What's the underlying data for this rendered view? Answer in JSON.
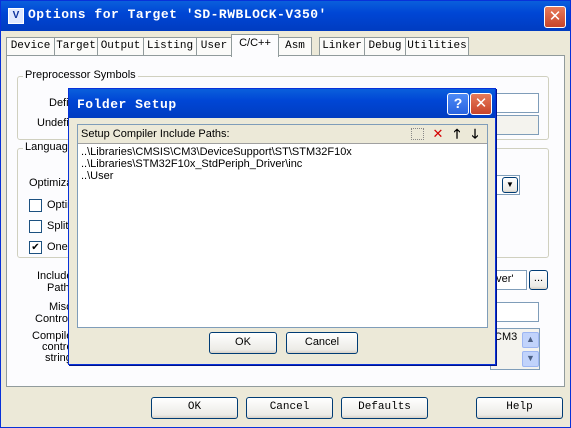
{
  "window": {
    "title": "Options for Target 'SD-RWBLOCK-V350'",
    "icon_glyph": "V"
  },
  "tabs": [
    "Device",
    "Target",
    "Output",
    "Listing",
    "User",
    "C/C++",
    "Asm",
    "Linker",
    "Debug",
    "Utilities"
  ],
  "active_tab": "C/C++",
  "preprocessor": {
    "group_label": "Preprocessor Symbols",
    "define_label": "Defin",
    "undefine_label": "Undefin"
  },
  "language": {
    "group_label": "Languag",
    "optimization_label": "Optimizat",
    "opt_checkbox_label": "Optin",
    "split_checkbox_label": "Split",
    "one_checkbox_label": "One",
    "opt_checked": false,
    "split_checked": false,
    "one_checked": true
  },
  "include": {
    "label_line1": "Include",
    "label_line2": "Paths",
    "value_visible": "river'",
    "browse_label": "..."
  },
  "misc": {
    "label_line1": "Misc",
    "label_line2": "Controls"
  },
  "compiler": {
    "label_line1": "Compiler",
    "label_line2": "control",
    "label_line3": "string",
    "value_visible": "CM3"
  },
  "bottom_buttons": {
    "ok": "OK",
    "cancel": "Cancel",
    "defaults": "Defaults",
    "help": "Help"
  },
  "dialog": {
    "title": "Folder Setup",
    "help_glyph": "?",
    "header_label": "Setup Compiler Include Paths:",
    "paths": [
      "..\\Libraries\\CMSIS\\CM3\\DeviceSupport\\ST\\STM32F10x",
      "..\\Libraries\\STM32F10x_StdPeriph_Driver\\inc",
      "..\\User"
    ],
    "ok_label": "OK",
    "cancel_label": "Cancel",
    "toolbar_icons": [
      "new-folder-icon",
      "delete-icon",
      "move-up-icon",
      "move-down-icon"
    ]
  },
  "colors": {
    "titlebar": "#0046d5",
    "close_button": "#c7442a",
    "delete_icon": "#d40000"
  }
}
